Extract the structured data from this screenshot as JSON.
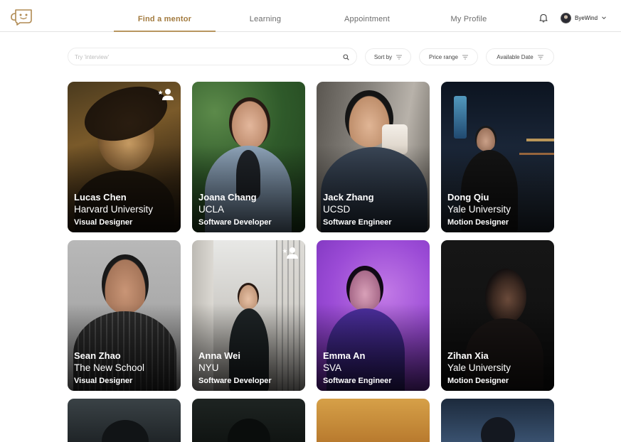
{
  "nav": {
    "tabs": [
      {
        "label": "Find a mentor",
        "active": true
      },
      {
        "label": "Learning",
        "active": false
      },
      {
        "label": "Appointment",
        "active": false
      },
      {
        "label": "My Profile",
        "active": false
      }
    ],
    "user_name": "ByeWind"
  },
  "search": {
    "placeholder": "Try 'interview'"
  },
  "filters": [
    {
      "label": "Sort by",
      "icon": "filter-icon"
    },
    {
      "label": "Price range",
      "icon": "filter-icon"
    },
    {
      "label": "Available Date",
      "icon": "filter-icon"
    }
  ],
  "mentors": [
    {
      "name": "Lucas Chen",
      "school": "Harvard University",
      "role": "Visual Designer",
      "favorite": true
    },
    {
      "name": "Joana Chang",
      "school": "UCLA",
      "role": "Software Developer",
      "favorite": false
    },
    {
      "name": "Jack Zhang",
      "school": "UCSD",
      "role": "Software Engineer",
      "favorite": false
    },
    {
      "name": "Dong Qiu",
      "school": "Yale University",
      "role": "Motion Designer",
      "favorite": false
    },
    {
      "name": "Sean Zhao",
      "school": "The New School",
      "role": "Visual Designer",
      "favorite": false
    },
    {
      "name": "Anna Wei",
      "school": "NYU",
      "role": "Software Developer",
      "favorite": true
    },
    {
      "name": "Emma An",
      "school": "SVA",
      "role": "Software Engineer",
      "favorite": false
    },
    {
      "name": "Zihan Xia",
      "school": "Yale University",
      "role": "Motion Designer",
      "favorite": false
    }
  ],
  "colors": {
    "accent": "#a27a3e",
    "accent_underline": "#b89660",
    "border": "#ececec"
  }
}
